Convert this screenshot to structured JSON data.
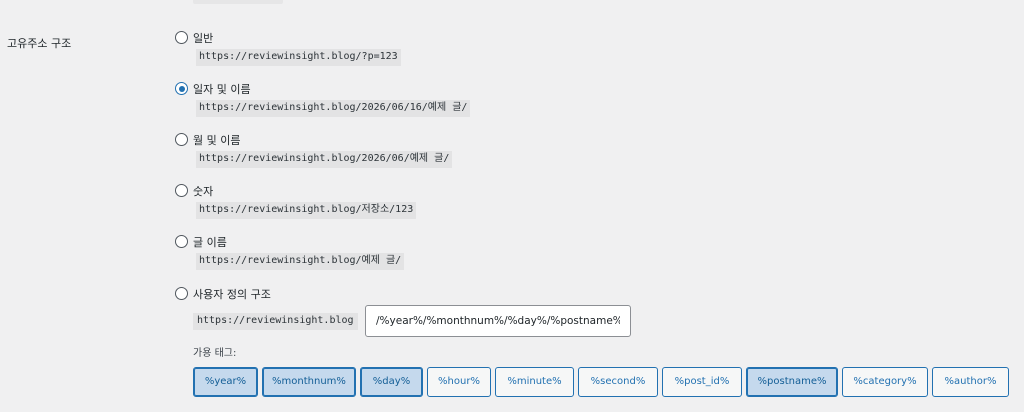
{
  "section_label": "고유주소 구조",
  "options": [
    {
      "label": "일반",
      "url": "https://reviewinsight.blog/?p=123",
      "checked": false
    },
    {
      "label": "일자 및 이름",
      "url": "https://reviewinsight.blog/2026/06/16/예제 글/",
      "checked": true
    },
    {
      "label": "월 및 이름",
      "url": "https://reviewinsight.blog/2026/06/예제 글/",
      "checked": false
    },
    {
      "label": "숫자",
      "url": "https://reviewinsight.blog/저장소/123",
      "checked": false
    },
    {
      "label": "글 이름",
      "url": "https://reviewinsight.blog/예제 글/",
      "checked": false
    },
    {
      "label": "사용자 정의 구조",
      "checked": false
    }
  ],
  "custom": {
    "prefix": "https://reviewinsight.blog",
    "structure": "/%year%/%monthnum%/%day%/%postname%/"
  },
  "tags_label": "가용 태그:",
  "tags": [
    {
      "label": "%year%",
      "active": true
    },
    {
      "label": "%monthnum%",
      "active": true
    },
    {
      "label": "%day%",
      "active": true
    },
    {
      "label": "%hour%",
      "active": false
    },
    {
      "label": "%minute%",
      "active": false
    },
    {
      "label": "%second%",
      "active": false
    },
    {
      "label": "%post_id%",
      "active": false
    },
    {
      "label": "%postname%",
      "active": true
    },
    {
      "label": "%category%",
      "active": false
    },
    {
      "label": "%author%",
      "active": false
    }
  ],
  "colors": {
    "accent": "#2271b1",
    "background": "#f0f0f1",
    "code_bg": "#e3e3e4"
  }
}
